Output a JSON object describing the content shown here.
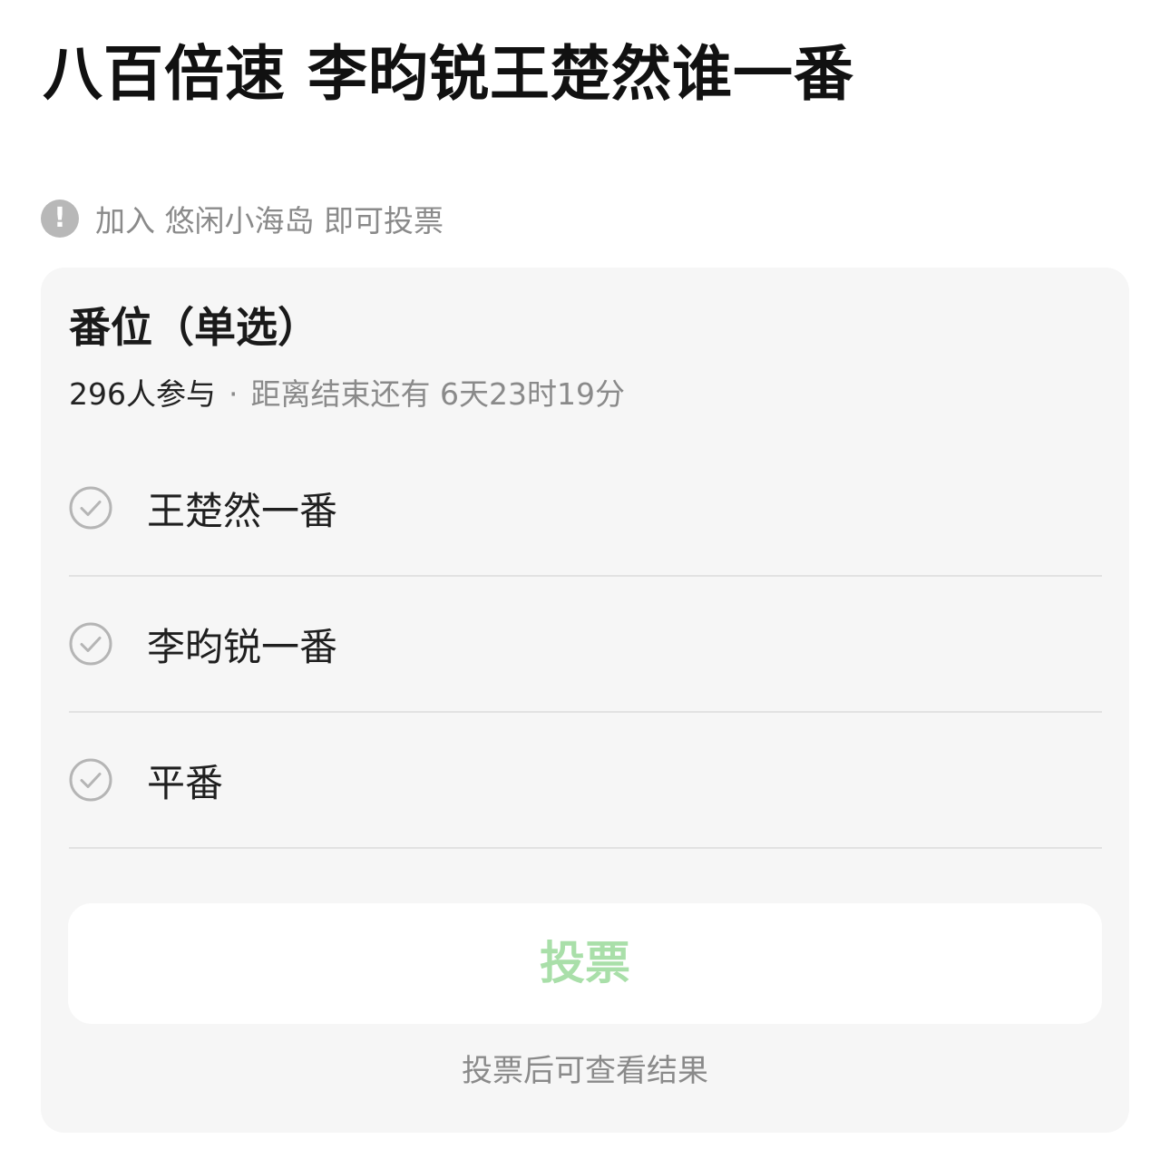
{
  "post": {
    "title": "八百倍速 李昀锐王楚然谁一番"
  },
  "notice": {
    "icon": "exclamation-circle-icon",
    "icon_glyph": "!",
    "text": "加入 悠闲小海岛 即可投票"
  },
  "poll": {
    "title": "番位（单选）",
    "participants": "296人参与",
    "separator": "·",
    "time_remaining": "距离结束还有 6天23时19分",
    "options": [
      {
        "label": "王楚然一番",
        "icon": "check-circle-icon"
      },
      {
        "label": "李昀锐一番",
        "icon": "check-circle-icon"
      },
      {
        "label": "平番",
        "icon": "check-circle-icon"
      }
    ],
    "vote_button_label": "投票",
    "result_hint": "投票后可查看结果"
  },
  "colors": {
    "accent_disabled": "#a9dfa9",
    "card_background": "#f6f6f6",
    "muted_text": "#8a8a8a"
  }
}
